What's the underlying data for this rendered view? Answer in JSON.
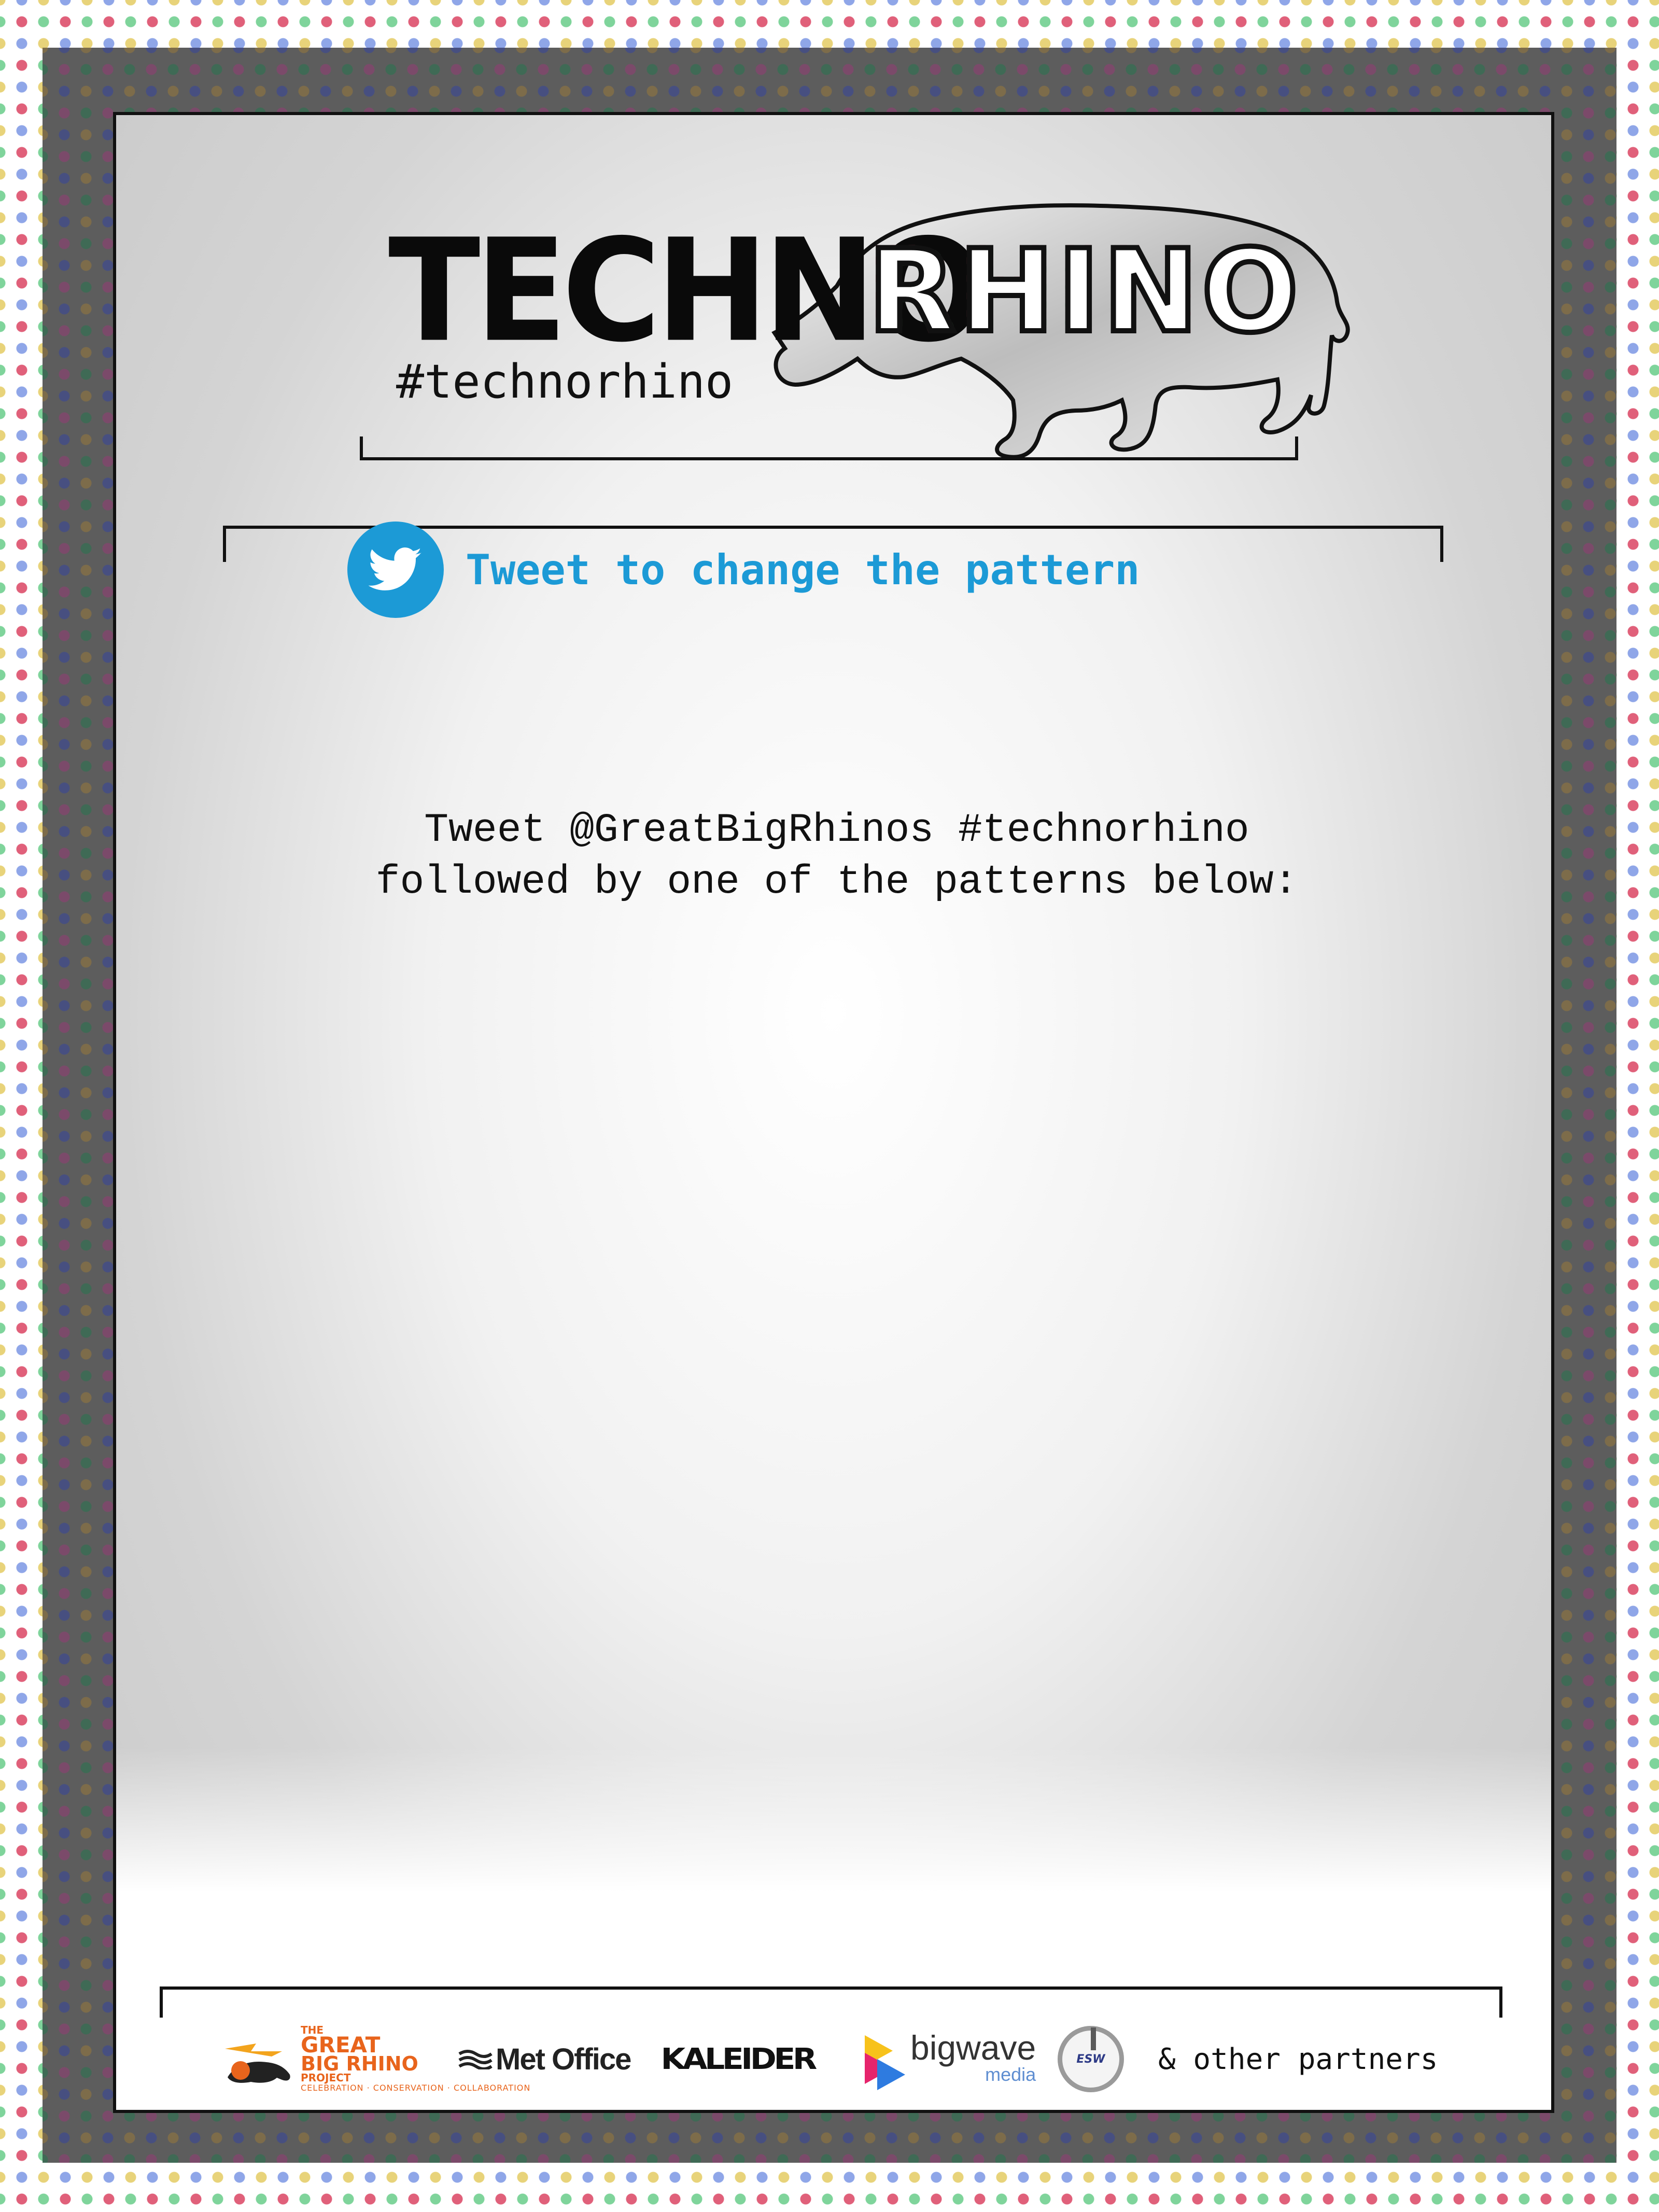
{
  "logo": {
    "techno": "TECHNO",
    "rhino": "RHINO",
    "hashtag": "#technorhino"
  },
  "tweet_prompt": {
    "icon": "twitter-bird-icon",
    "label": "Tweet to change the pattern"
  },
  "instructions": {
    "line1": "Tweet @GreatBigRhinos #technorhino",
    "line2": "followed by one of the patterns below:"
  },
  "partners": {
    "great_big_rhino": {
      "line1": "THE",
      "line2": "GREAT",
      "line3": "BIG RHINO",
      "line4": "PROJECT",
      "tagline": "CELEBRATION · CONSERVATION · COLLABORATION"
    },
    "met_office": "Met Office",
    "kaleider": "KALEIDER",
    "bigwave": {
      "name": "bigwave",
      "sub": "media"
    },
    "esw": "ESW",
    "others": "& other partners"
  },
  "colors": {
    "accent": "#1c9ad6",
    "frame": "#111111",
    "gbr_orange": "#e8641c"
  }
}
